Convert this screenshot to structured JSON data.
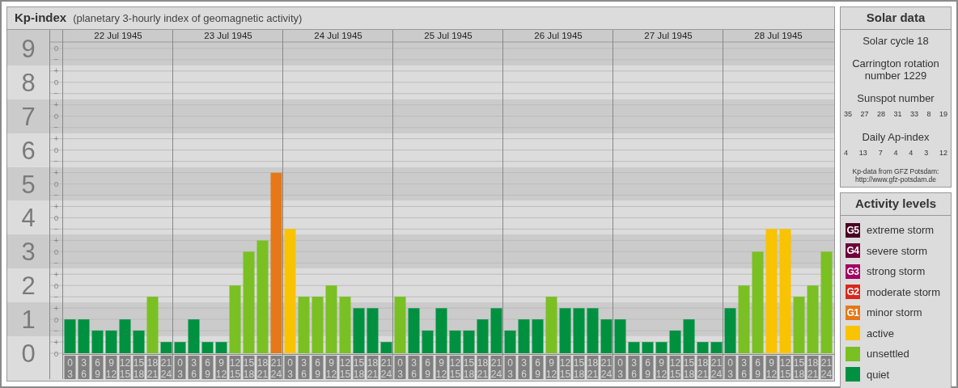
{
  "kp_chart": {
    "title": "Kp-index",
    "subtitle": "(planetary 3-hourly index of geomagnetic activity)",
    "days": [
      {
        "date": "22 Jul 1945",
        "slots": [
          {
            "start": "0",
            "end": "3"
          },
          {
            "start": "3",
            "end": "6"
          },
          {
            "start": "6",
            "end": "9"
          },
          {
            "start": "9",
            "end": "12"
          },
          {
            "start": "12",
            "end": "15"
          },
          {
            "start": "15",
            "end": "18"
          },
          {
            "start": "18",
            "end": "21"
          },
          {
            "start": "21",
            "end": "24"
          }
        ]
      },
      {
        "date": "23 Jul 1945",
        "slots": [
          {
            "start": "0",
            "end": "3"
          },
          {
            "start": "3",
            "end": "6"
          },
          {
            "start": "6",
            "end": "9"
          },
          {
            "start": "9",
            "end": "12"
          },
          {
            "start": "12",
            "end": "15"
          },
          {
            "start": "15",
            "end": "18"
          },
          {
            "start": "18",
            "end": "21"
          },
          {
            "start": "21",
            "end": "24"
          }
        ]
      },
      {
        "date": "24 Jul 1945",
        "slots": [
          {
            "start": "0",
            "end": "3"
          },
          {
            "start": "3",
            "end": "6"
          },
          {
            "start": "6",
            "end": "9"
          },
          {
            "start": "9",
            "end": "12"
          },
          {
            "start": "12",
            "end": "15"
          },
          {
            "start": "15",
            "end": "18"
          },
          {
            "start": "18",
            "end": "21"
          },
          {
            "start": "21",
            "end": "24"
          }
        ]
      },
      {
        "date": "25 Jul 1945",
        "slots": [
          {
            "start": "0",
            "end": "3"
          },
          {
            "start": "3",
            "end": "6"
          },
          {
            "start": "6",
            "end": "9"
          },
          {
            "start": "9",
            "end": "12"
          },
          {
            "start": "12",
            "end": "15"
          },
          {
            "start": "15",
            "end": "18"
          },
          {
            "start": "18",
            "end": "21"
          },
          {
            "start": "21",
            "end": "24"
          }
        ]
      },
      {
        "date": "26 Jul 1945",
        "slots": [
          {
            "start": "0",
            "end": "3"
          },
          {
            "start": "3",
            "end": "6"
          },
          {
            "start": "6",
            "end": "9"
          },
          {
            "start": "9",
            "end": "12"
          },
          {
            "start": "12",
            "end": "15"
          },
          {
            "start": "15",
            "end": "18"
          },
          {
            "start": "18",
            "end": "21"
          },
          {
            "start": "21",
            "end": "24"
          }
        ]
      },
      {
        "date": "27 Jul 1945",
        "slots": [
          {
            "start": "0",
            "end": "3"
          },
          {
            "start": "3",
            "end": "6"
          },
          {
            "start": "6",
            "end": "9"
          },
          {
            "start": "9",
            "end": "12"
          },
          {
            "start": "12",
            "end": "15"
          },
          {
            "start": "15",
            "end": "18"
          },
          {
            "start": "18",
            "end": "21"
          },
          {
            "start": "21",
            "end": "24"
          }
        ]
      },
      {
        "date": "28 Jul 1945",
        "slots": [
          {
            "start": "0",
            "end": "3"
          },
          {
            "start": "3",
            "end": "6"
          },
          {
            "start": "6",
            "end": "9"
          },
          {
            "start": "9",
            "end": "12"
          },
          {
            "start": "12",
            "end": "15"
          },
          {
            "start": "15",
            "end": "18"
          },
          {
            "start": "18",
            "end": "21"
          },
          {
            "start": "21",
            "end": "24"
          }
        ]
      }
    ],
    "minor_tick_labels": [
      "o",
      "−",
      "+",
      "o",
      "−",
      "+",
      "o",
      "−",
      "+",
      "o",
      "−",
      "+",
      "o",
      "−",
      "+",
      "o",
      "−",
      "+",
      "o",
      "−",
      "+",
      "o",
      "−",
      "+",
      "o",
      "−",
      "+",
      "o"
    ],
    "chart_data": {
      "type": "bar",
      "stacked": true,
      "ylim": [
        0,
        9.19
      ],
      "yticks": [
        {
          "value": 0,
          "label": "0"
        },
        {
          "value": 1,
          "label": "1"
        },
        {
          "value": 2,
          "label": "2"
        },
        {
          "value": 3,
          "label": "3"
        },
        {
          "value": 4,
          "label": "4"
        },
        {
          "value": 5,
          "label": "5"
        },
        {
          "value": 6,
          "label": "6"
        },
        {
          "value": 7,
          "label": "7"
        },
        {
          "value": 8,
          "label": "8"
        },
        {
          "value": 9,
          "label": "9"
        }
      ],
      "grid": true,
      "series": [
        {
          "color": "#009140",
          "values": [
            1,
            1,
            0.67,
            0.67,
            1,
            0.67,
            null,
            0.33,
            0.33,
            1,
            0.33,
            0.33,
            null,
            null,
            null,
            null,
            null,
            null,
            null,
            null,
            null,
            1.33,
            1.33,
            0.33,
            null,
            1.33,
            0.67,
            1.33,
            0.67,
            0.67,
            1,
            1.33,
            0.67,
            1,
            1,
            null,
            1.33,
            1.33,
            1.33,
            1,
            1,
            0.33,
            0.33,
            0.33,
            0.67,
            1,
            0.33,
            0.33,
            1.33,
            null,
            null,
            null,
            null,
            null,
            null,
            null
          ]
        },
        {
          "color": "#7ac023",
          "values": [
            null,
            null,
            null,
            null,
            null,
            null,
            1.67,
            null,
            null,
            null,
            null,
            null,
            2,
            3,
            3.33,
            null,
            null,
            1.67,
            1.67,
            2,
            1.67,
            null,
            null,
            null,
            1.67,
            null,
            null,
            null,
            null,
            null,
            null,
            null,
            null,
            null,
            null,
            1.67,
            null,
            null,
            null,
            null,
            null,
            null,
            null,
            null,
            null,
            null,
            null,
            null,
            null,
            2,
            3,
            null,
            null,
            1.67,
            2,
            3
          ]
        },
        {
          "color": "#f9c300",
          "values": [
            null,
            null,
            null,
            null,
            null,
            null,
            null,
            null,
            null,
            null,
            null,
            null,
            null,
            null,
            null,
            null,
            3.67,
            null,
            null,
            null,
            null,
            null,
            null,
            null,
            null,
            null,
            null,
            null,
            null,
            null,
            null,
            null,
            null,
            null,
            null,
            null,
            null,
            null,
            null,
            null,
            null,
            null,
            null,
            null,
            null,
            null,
            null,
            null,
            null,
            null,
            null,
            3.67,
            3.67,
            null,
            null,
            null
          ]
        },
        {
          "color": "#e67817",
          "values": [
            null,
            null,
            null,
            null,
            null,
            null,
            null,
            null,
            null,
            null,
            null,
            null,
            null,
            null,
            null,
            5.33,
            null,
            null,
            null,
            null,
            null,
            null,
            null,
            null,
            null,
            null,
            null,
            null,
            null,
            null,
            null,
            null,
            null,
            null,
            null,
            null,
            null,
            null,
            null,
            null,
            null,
            null,
            null,
            null,
            null,
            null,
            null,
            null,
            null,
            null,
            null,
            null,
            null,
            null,
            null,
            null
          ]
        }
      ]
    }
  },
  "solar_data": {
    "title": "Solar data",
    "solar_cycle": "Solar cycle 18",
    "carrington_rotation": "Carrington rotation number 1229",
    "sunspot_heading": "Sunspot number",
    "sunspot_numbers": [
      "35",
      "27",
      "28",
      "31",
      "33",
      "8",
      "19"
    ],
    "ap_heading": "Daily Ap-index",
    "ap_values": [
      "4",
      "13",
      "7",
      "4",
      "4",
      "3",
      "12"
    ],
    "source_note": "Kp-data from GFZ Potsdam:",
    "source_link": "http://www.gfz-potsdam.de"
  },
  "activity_levels": {
    "title": "Activity levels",
    "items": [
      {
        "code": "G5",
        "label": "extreme storm",
        "color": "#4a0024"
      },
      {
        "code": "G4",
        "label": "severe storm",
        "color": "#6d0038"
      },
      {
        "code": "G3",
        "label": "strong storm",
        "color": "#a40062"
      },
      {
        "code": "G2",
        "label": "moderate storm",
        "color": "#d9281c"
      },
      {
        "code": "G1",
        "label": "minor storm",
        "color": "#e67817"
      },
      {
        "label": "active",
        "color": "#f9c300"
      },
      {
        "label": "unsettled",
        "color": "#7ac023"
      },
      {
        "label": "quiet",
        "color": "#009140"
      }
    ]
  }
}
